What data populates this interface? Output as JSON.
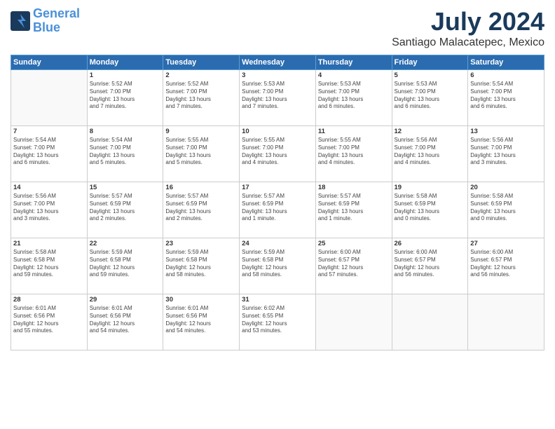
{
  "header": {
    "logo_line1": "General",
    "logo_line2": "Blue",
    "month": "July 2024",
    "location": "Santiago Malacatepec, Mexico"
  },
  "weekdays": [
    "Sunday",
    "Monday",
    "Tuesday",
    "Wednesday",
    "Thursday",
    "Friday",
    "Saturday"
  ],
  "weeks": [
    [
      {
        "day": "",
        "info": ""
      },
      {
        "day": "1",
        "info": "Sunrise: 5:52 AM\nSunset: 7:00 PM\nDaylight: 13 hours\nand 7 minutes."
      },
      {
        "day": "2",
        "info": "Sunrise: 5:52 AM\nSunset: 7:00 PM\nDaylight: 13 hours\nand 7 minutes."
      },
      {
        "day": "3",
        "info": "Sunrise: 5:53 AM\nSunset: 7:00 PM\nDaylight: 13 hours\nand 7 minutes."
      },
      {
        "day": "4",
        "info": "Sunrise: 5:53 AM\nSunset: 7:00 PM\nDaylight: 13 hours\nand 6 minutes."
      },
      {
        "day": "5",
        "info": "Sunrise: 5:53 AM\nSunset: 7:00 PM\nDaylight: 13 hours\nand 6 minutes."
      },
      {
        "day": "6",
        "info": "Sunrise: 5:54 AM\nSunset: 7:00 PM\nDaylight: 13 hours\nand 6 minutes."
      }
    ],
    [
      {
        "day": "7",
        "info": "Sunrise: 5:54 AM\nSunset: 7:00 PM\nDaylight: 13 hours\nand 6 minutes."
      },
      {
        "day": "8",
        "info": "Sunrise: 5:54 AM\nSunset: 7:00 PM\nDaylight: 13 hours\nand 5 minutes."
      },
      {
        "day": "9",
        "info": "Sunrise: 5:55 AM\nSunset: 7:00 PM\nDaylight: 13 hours\nand 5 minutes."
      },
      {
        "day": "10",
        "info": "Sunrise: 5:55 AM\nSunset: 7:00 PM\nDaylight: 13 hours\nand 4 minutes."
      },
      {
        "day": "11",
        "info": "Sunrise: 5:55 AM\nSunset: 7:00 PM\nDaylight: 13 hours\nand 4 minutes."
      },
      {
        "day": "12",
        "info": "Sunrise: 5:56 AM\nSunset: 7:00 PM\nDaylight: 13 hours\nand 4 minutes."
      },
      {
        "day": "13",
        "info": "Sunrise: 5:56 AM\nSunset: 7:00 PM\nDaylight: 13 hours\nand 3 minutes."
      }
    ],
    [
      {
        "day": "14",
        "info": "Sunrise: 5:56 AM\nSunset: 7:00 PM\nDaylight: 13 hours\nand 3 minutes."
      },
      {
        "day": "15",
        "info": "Sunrise: 5:57 AM\nSunset: 6:59 PM\nDaylight: 13 hours\nand 2 minutes."
      },
      {
        "day": "16",
        "info": "Sunrise: 5:57 AM\nSunset: 6:59 PM\nDaylight: 13 hours\nand 2 minutes."
      },
      {
        "day": "17",
        "info": "Sunrise: 5:57 AM\nSunset: 6:59 PM\nDaylight: 13 hours\nand 1 minute."
      },
      {
        "day": "18",
        "info": "Sunrise: 5:57 AM\nSunset: 6:59 PM\nDaylight: 13 hours\nand 1 minute."
      },
      {
        "day": "19",
        "info": "Sunrise: 5:58 AM\nSunset: 6:59 PM\nDaylight: 13 hours\nand 0 minutes."
      },
      {
        "day": "20",
        "info": "Sunrise: 5:58 AM\nSunset: 6:59 PM\nDaylight: 13 hours\nand 0 minutes."
      }
    ],
    [
      {
        "day": "21",
        "info": "Sunrise: 5:58 AM\nSunset: 6:58 PM\nDaylight: 12 hours\nand 59 minutes."
      },
      {
        "day": "22",
        "info": "Sunrise: 5:59 AM\nSunset: 6:58 PM\nDaylight: 12 hours\nand 59 minutes."
      },
      {
        "day": "23",
        "info": "Sunrise: 5:59 AM\nSunset: 6:58 PM\nDaylight: 12 hours\nand 58 minutes."
      },
      {
        "day": "24",
        "info": "Sunrise: 5:59 AM\nSunset: 6:58 PM\nDaylight: 12 hours\nand 58 minutes."
      },
      {
        "day": "25",
        "info": "Sunrise: 6:00 AM\nSunset: 6:57 PM\nDaylight: 12 hours\nand 57 minutes."
      },
      {
        "day": "26",
        "info": "Sunrise: 6:00 AM\nSunset: 6:57 PM\nDaylight: 12 hours\nand 56 minutes."
      },
      {
        "day": "27",
        "info": "Sunrise: 6:00 AM\nSunset: 6:57 PM\nDaylight: 12 hours\nand 56 minutes."
      }
    ],
    [
      {
        "day": "28",
        "info": "Sunrise: 6:01 AM\nSunset: 6:56 PM\nDaylight: 12 hours\nand 55 minutes."
      },
      {
        "day": "29",
        "info": "Sunrise: 6:01 AM\nSunset: 6:56 PM\nDaylight: 12 hours\nand 54 minutes."
      },
      {
        "day": "30",
        "info": "Sunrise: 6:01 AM\nSunset: 6:56 PM\nDaylight: 12 hours\nand 54 minutes."
      },
      {
        "day": "31",
        "info": "Sunrise: 6:02 AM\nSunset: 6:55 PM\nDaylight: 12 hours\nand 53 minutes."
      },
      {
        "day": "",
        "info": ""
      },
      {
        "day": "",
        "info": ""
      },
      {
        "day": "",
        "info": ""
      }
    ]
  ]
}
